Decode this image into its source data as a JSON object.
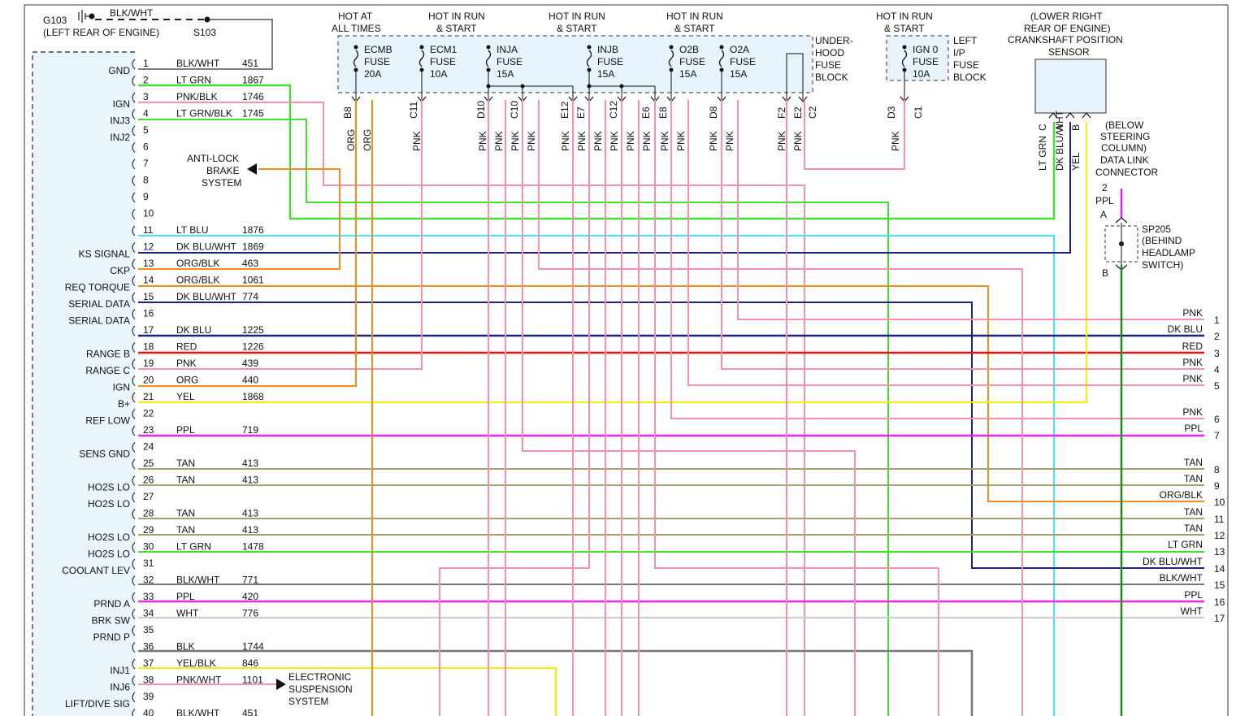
{
  "ground": {
    "id": "G103",
    "location": "(LEFT REAR OF ENGINE)",
    "wire": "BLK/WHT",
    "splice": "S103"
  },
  "pins": [
    {
      "n": "1",
      "func": "GND",
      "color": "BLK/WHT",
      "circuit": "451"
    },
    {
      "n": "2",
      "func": "",
      "color": "LT GRN",
      "circuit": "1867"
    },
    {
      "n": "3",
      "func": "IGN",
      "color": "PNK/BLK",
      "circuit": "1746"
    },
    {
      "n": "4",
      "func": "INJ3",
      "color": "LT GRN/BLK",
      "circuit": "1745"
    },
    {
      "n": "5",
      "func": "INJ2",
      "color": "",
      "circuit": ""
    },
    {
      "n": "6",
      "func": "",
      "color": "",
      "circuit": ""
    },
    {
      "n": "7",
      "func": "",
      "color": "",
      "circuit": ""
    },
    {
      "n": "8",
      "func": "",
      "color": "",
      "circuit": ""
    },
    {
      "n": "9",
      "func": "",
      "color": "",
      "circuit": ""
    },
    {
      "n": "10",
      "func": "",
      "color": "",
      "circuit": ""
    },
    {
      "n": "11",
      "func": "",
      "color": "LT BLU",
      "circuit": "1876"
    },
    {
      "n": "12",
      "func": "KS SIGNAL",
      "color": "DK BLU/WHT",
      "circuit": "1869"
    },
    {
      "n": "13",
      "func": "CKP",
      "color": "ORG/BLK",
      "circuit": "463"
    },
    {
      "n": "14",
      "func": "REQ TORQUE",
      "color": "ORG/BLK",
      "circuit": "1061"
    },
    {
      "n": "15",
      "func": "SERIAL DATA",
      "color": "DK BLU/WHT",
      "circuit": "774"
    },
    {
      "n": "16",
      "func": "SERIAL DATA",
      "color": "",
      "circuit": ""
    },
    {
      "n": "17",
      "func": "",
      "color": "DK BLU",
      "circuit": "1225"
    },
    {
      "n": "18",
      "func": "RANGE B",
      "color": "RED",
      "circuit": "1226"
    },
    {
      "n": "19",
      "func": "RANGE C",
      "color": "PNK",
      "circuit": "439"
    },
    {
      "n": "20",
      "func": "IGN",
      "color": "ORG",
      "circuit": "440"
    },
    {
      "n": "21",
      "func": "B+",
      "color": "YEL",
      "circuit": "1868"
    },
    {
      "n": "22",
      "func": "REF LOW",
      "color": "",
      "circuit": ""
    },
    {
      "n": "23",
      "func": "",
      "color": "PPL",
      "circuit": "719"
    },
    {
      "n": "24",
      "func": "SENS GND",
      "color": "",
      "circuit": ""
    },
    {
      "n": "25",
      "func": "",
      "color": "TAN",
      "circuit": "413"
    },
    {
      "n": "26",
      "func": "HO2S LO",
      "color": "TAN",
      "circuit": "413"
    },
    {
      "n": "27",
      "func": "HO2S LO",
      "color": "",
      "circuit": ""
    },
    {
      "n": "28",
      "func": "",
      "color": "TAN",
      "circuit": "413"
    },
    {
      "n": "29",
      "func": "HO2S LO",
      "color": "TAN",
      "circuit": "413"
    },
    {
      "n": "30",
      "func": "HO2S LO",
      "color": "LT GRN",
      "circuit": "1478"
    },
    {
      "n": "31",
      "func": "COOLANT LEV",
      "color": "",
      "circuit": ""
    },
    {
      "n": "32",
      "func": "",
      "color": "BLK/WHT",
      "circuit": "771"
    },
    {
      "n": "33",
      "func": "PRND A",
      "color": "PPL",
      "circuit": "420"
    },
    {
      "n": "34",
      "func": "BRK SW",
      "color": "WHT",
      "circuit": "776"
    },
    {
      "n": "35",
      "func": "PRND P",
      "color": "",
      "circuit": ""
    },
    {
      "n": "36",
      "func": "",
      "color": "BLK",
      "circuit": "1744"
    },
    {
      "n": "37",
      "func": "INJ1",
      "color": "YEL/BLK",
      "circuit": "846"
    },
    {
      "n": "38",
      "func": "INJ6",
      "color": "PNK/WHT",
      "circuit": "1101"
    },
    {
      "n": "39",
      "func": "LIFT/DIVE SIG",
      "color": "",
      "circuit": ""
    },
    {
      "n": "40",
      "func": "",
      "color": "BLK/WHT",
      "circuit": "451"
    }
  ],
  "abs_label": [
    "ANTI-LOCK",
    "BRAKE",
    "SYSTEM"
  ],
  "esc_label": [
    "ELECTRONIC",
    "SUSPENSION",
    "SYSTEM"
  ],
  "hot_labels": [
    [
      "HOT AT",
      "ALL TIMES"
    ],
    [
      "HOT IN RUN",
      "& START"
    ],
    [
      "HOT IN RUN",
      "& START"
    ],
    [
      "HOT IN RUN",
      "& START"
    ],
    [
      "HOT IN RUN",
      "& START"
    ]
  ],
  "fuses": [
    [
      "ECMB",
      "FUSE",
      "20A"
    ],
    [
      "ECM1",
      "FUSE",
      "10A"
    ],
    [
      "INJA",
      "FUSE",
      "15A"
    ],
    [
      "INJB",
      "FUSE",
      "15A"
    ],
    [
      "O2B",
      "FUSE",
      "15A"
    ],
    [
      "O2A",
      "FUSE",
      "15A"
    ]
  ],
  "underhood_block": [
    "UNDER-",
    "HOOD",
    "FUSE",
    "BLOCK"
  ],
  "ign_fuse": [
    "IGN 0",
    "FUSE",
    "10A"
  ],
  "left_ip_block": [
    "LEFT",
    "I/P",
    "FUSE",
    "BLOCK"
  ],
  "terminals": [
    "B8",
    "C11",
    "D10",
    "C10",
    "E12",
    "E7",
    "C12",
    "E6",
    "E8",
    "D8",
    "F2",
    "E2",
    "C2",
    "D3",
    "C1"
  ],
  "wire_colors_top": [
    "ORG",
    "ORG",
    "PNK",
    "PNK",
    "PNK",
    "PNK",
    "PNK",
    "PNK",
    "PNK",
    "PNK",
    "PNK",
    "PNK",
    "PNK",
    "PNK",
    "PNK",
    "PNK",
    "PNK"
  ],
  "ckp_sensor": [
    "(LOWER RIGHT",
    "REAR OF ENGINE)",
    "CRANKSHAFT POSITION",
    "SENSOR"
  ],
  "ckp_pins": [
    "C",
    "A",
    "B"
  ],
  "ckp_wires": [
    "LT GRN",
    "DK BLU/WHT",
    "YEL"
  ],
  "dlc_label": [
    "(BELOW",
    "STEERING",
    "COLUMN)",
    "DATA LINK",
    "CONNECTOR"
  ],
  "dlc_pin": "2",
  "dlc_wire": "PPL",
  "splice": {
    "id": "SP205",
    "desc": [
      "(BEHIND",
      "HEADLAMP",
      "SWITCH)"
    ],
    "a": "A",
    "b": "B"
  },
  "right_wires": [
    {
      "n": "1",
      "color": "PNK"
    },
    {
      "n": "2",
      "color": "DK BLU"
    },
    {
      "n": "3",
      "color": "RED"
    },
    {
      "n": "4",
      "color": "PNK"
    },
    {
      "n": "5",
      "color": "PNK"
    },
    {
      "n": "6",
      "color": "PNK"
    },
    {
      "n": "7",
      "color": "PPL"
    },
    {
      "n": "8",
      "color": "TAN"
    },
    {
      "n": "9",
      "color": "TAN"
    },
    {
      "n": "10",
      "color": "ORG/BLK"
    },
    {
      "n": "11",
      "color": "TAN"
    },
    {
      "n": "12",
      "color": "TAN"
    },
    {
      "n": "13",
      "color": "LT GRN"
    },
    {
      "n": "14",
      "color": "DK BLU/WHT"
    },
    {
      "n": "15",
      "color": "BLK/WHT"
    },
    {
      "n": "16",
      "color": "PPL"
    },
    {
      "n": "17",
      "color": "WHT"
    }
  ],
  "palette": {
    "pink": "#f78fb0",
    "orange": "#f28c1c",
    "green": "#44dd33",
    "cyan": "#3ee8ee",
    "navy": "#1a237e",
    "darkblue": "#22337e",
    "red": "#ee1111",
    "yellow": "#f5f000",
    "magenta": "#ee22ee",
    "tan": "#a8a070",
    "gray": "#777777",
    "darkgreen": "#1f8a1f",
    "lightgray": "#cccccc",
    "fuseblock": "#e6f3fb",
    "module": "#e9f5fb"
  }
}
